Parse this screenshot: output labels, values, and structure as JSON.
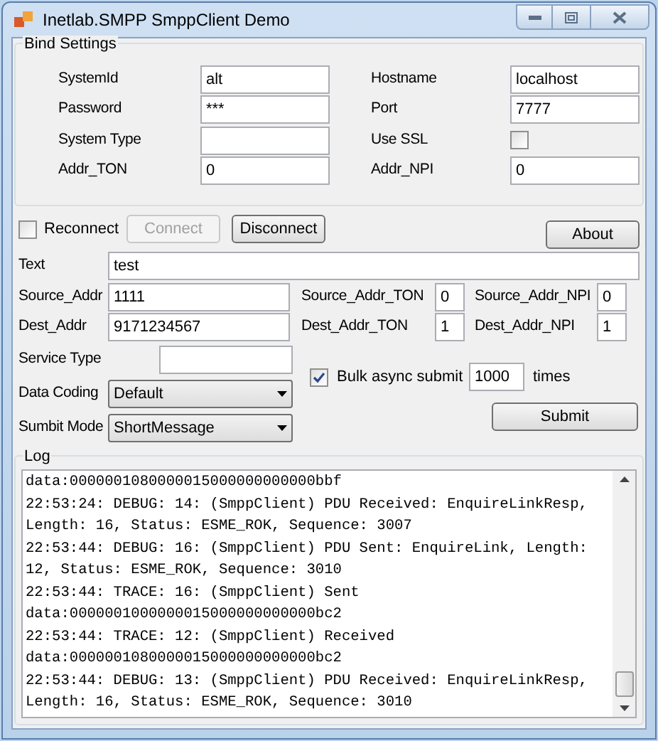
{
  "window": {
    "title": "Inetlab.SMPP SmppClient Demo"
  },
  "bind_settings": {
    "title": "Bind Settings",
    "left": [
      {
        "kind": "text",
        "label": "SystemId",
        "value": "alt"
      },
      {
        "kind": "text",
        "label": "Password",
        "value": "***"
      },
      {
        "kind": "text",
        "label": "System Type"
      },
      {
        "kind": "text",
        "label": "Addr_TON",
        "value": "0"
      }
    ],
    "right": [
      {
        "kind": "text",
        "label": "Hostname",
        "value": "localhost"
      },
      {
        "kind": "text",
        "label": "Port",
        "value": "7777"
      },
      {
        "kind": "checkbox",
        "label": "Use SSL",
        "checked": false
      },
      {
        "kind": "text",
        "label": "Addr_NPI",
        "value": "0"
      }
    ]
  },
  "connection": {
    "reconnect": {
      "label": "Reconnect",
      "checked": false
    },
    "buttons": [
      {
        "label": "Connect",
        "disabled": true
      },
      {
        "label": "Disconnect",
        "disabled": false
      }
    ],
    "about": "About"
  },
  "message": {
    "text": {
      "label": "Text",
      "value": "test"
    },
    "rows": [
      [
        {
          "label": "Source_Addr",
          "value": "1111"
        },
        {
          "label": "Source_Addr_TON",
          "value": "0"
        },
        {
          "label": "Source_Addr_NPI",
          "value": "0"
        }
      ],
      [
        {
          "label": "Dest_Addr",
          "value": "9171234567"
        },
        {
          "label": "Dest_Addr_TON",
          "value": "1"
        },
        {
          "label": "Dest_Addr_NPI",
          "value": "1"
        }
      ]
    ],
    "service_type": {
      "label": "Service Type"
    },
    "bulk": {
      "label": "Bulk async submit",
      "checked": true,
      "count": "1000",
      "suffix": "times"
    },
    "data_coding": {
      "label": "Data Coding",
      "value": "Default"
    },
    "submit_mode": {
      "label": "Sumbit Mode",
      "value": "ShortMessage"
    },
    "submit": "Submit"
  },
  "log": {
    "title": "Log",
    "lines": [
      "data:0000001080000015000000000000bbf",
      "22:53:24: DEBUG: 14: (SmppClient) PDU Received: EnquireLinkResp,",
      "Length: 16, Status: ESME_ROK, Sequence: 3007",
      "22:53:44: DEBUG: 16: (SmppClient) PDU Sent: EnquireLink, Length:",
      "12, Status: ESME_ROK, Sequence: 3010",
      "22:53:44: TRACE: 16: (SmppClient) Sent",
      "data:0000001000000015000000000000bc2",
      "22:53:44: TRACE: 12: (SmppClient) Received",
      "data:0000001080000015000000000000bc2",
      "22:53:44: DEBUG: 13: (SmppClient) PDU Received: EnquireLinkResp,",
      "Length: 16, Status: ESME_ROK, Sequence: 3010"
    ]
  }
}
